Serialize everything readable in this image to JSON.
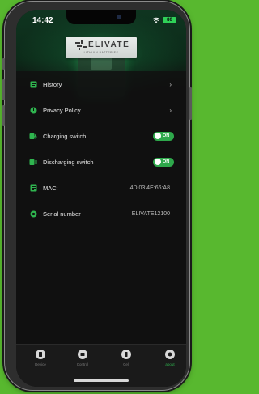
{
  "status_bar": {
    "time": "14:42",
    "battery": "80"
  },
  "brand": {
    "name": "ELIVATE",
    "tagline": "LITHIUM BATTERIES"
  },
  "menu": {
    "items": [
      {
        "label": "History",
        "type": "link"
      },
      {
        "label": "Privacy Policy",
        "type": "link"
      },
      {
        "label": "Charging switch",
        "type": "toggle",
        "state": "ON"
      },
      {
        "label": "Discharging switch",
        "type": "toggle",
        "state": "ON"
      },
      {
        "label": "MAC:",
        "type": "info",
        "value": "4D:03:4E:66:A8"
      },
      {
        "label": "Serial number",
        "type": "info",
        "value": "ELIVATE12100"
      }
    ]
  },
  "tabbar": {
    "tabs": [
      {
        "label": "Device",
        "active": false
      },
      {
        "label": "Control",
        "active": false
      },
      {
        "label": "Cell",
        "active": false
      },
      {
        "label": "about",
        "active": true
      }
    ]
  },
  "colors": {
    "accent": "#2fb54f",
    "toggle_on": "#2ea84b",
    "background": "#101010",
    "outer_background": "#58b82f"
  }
}
